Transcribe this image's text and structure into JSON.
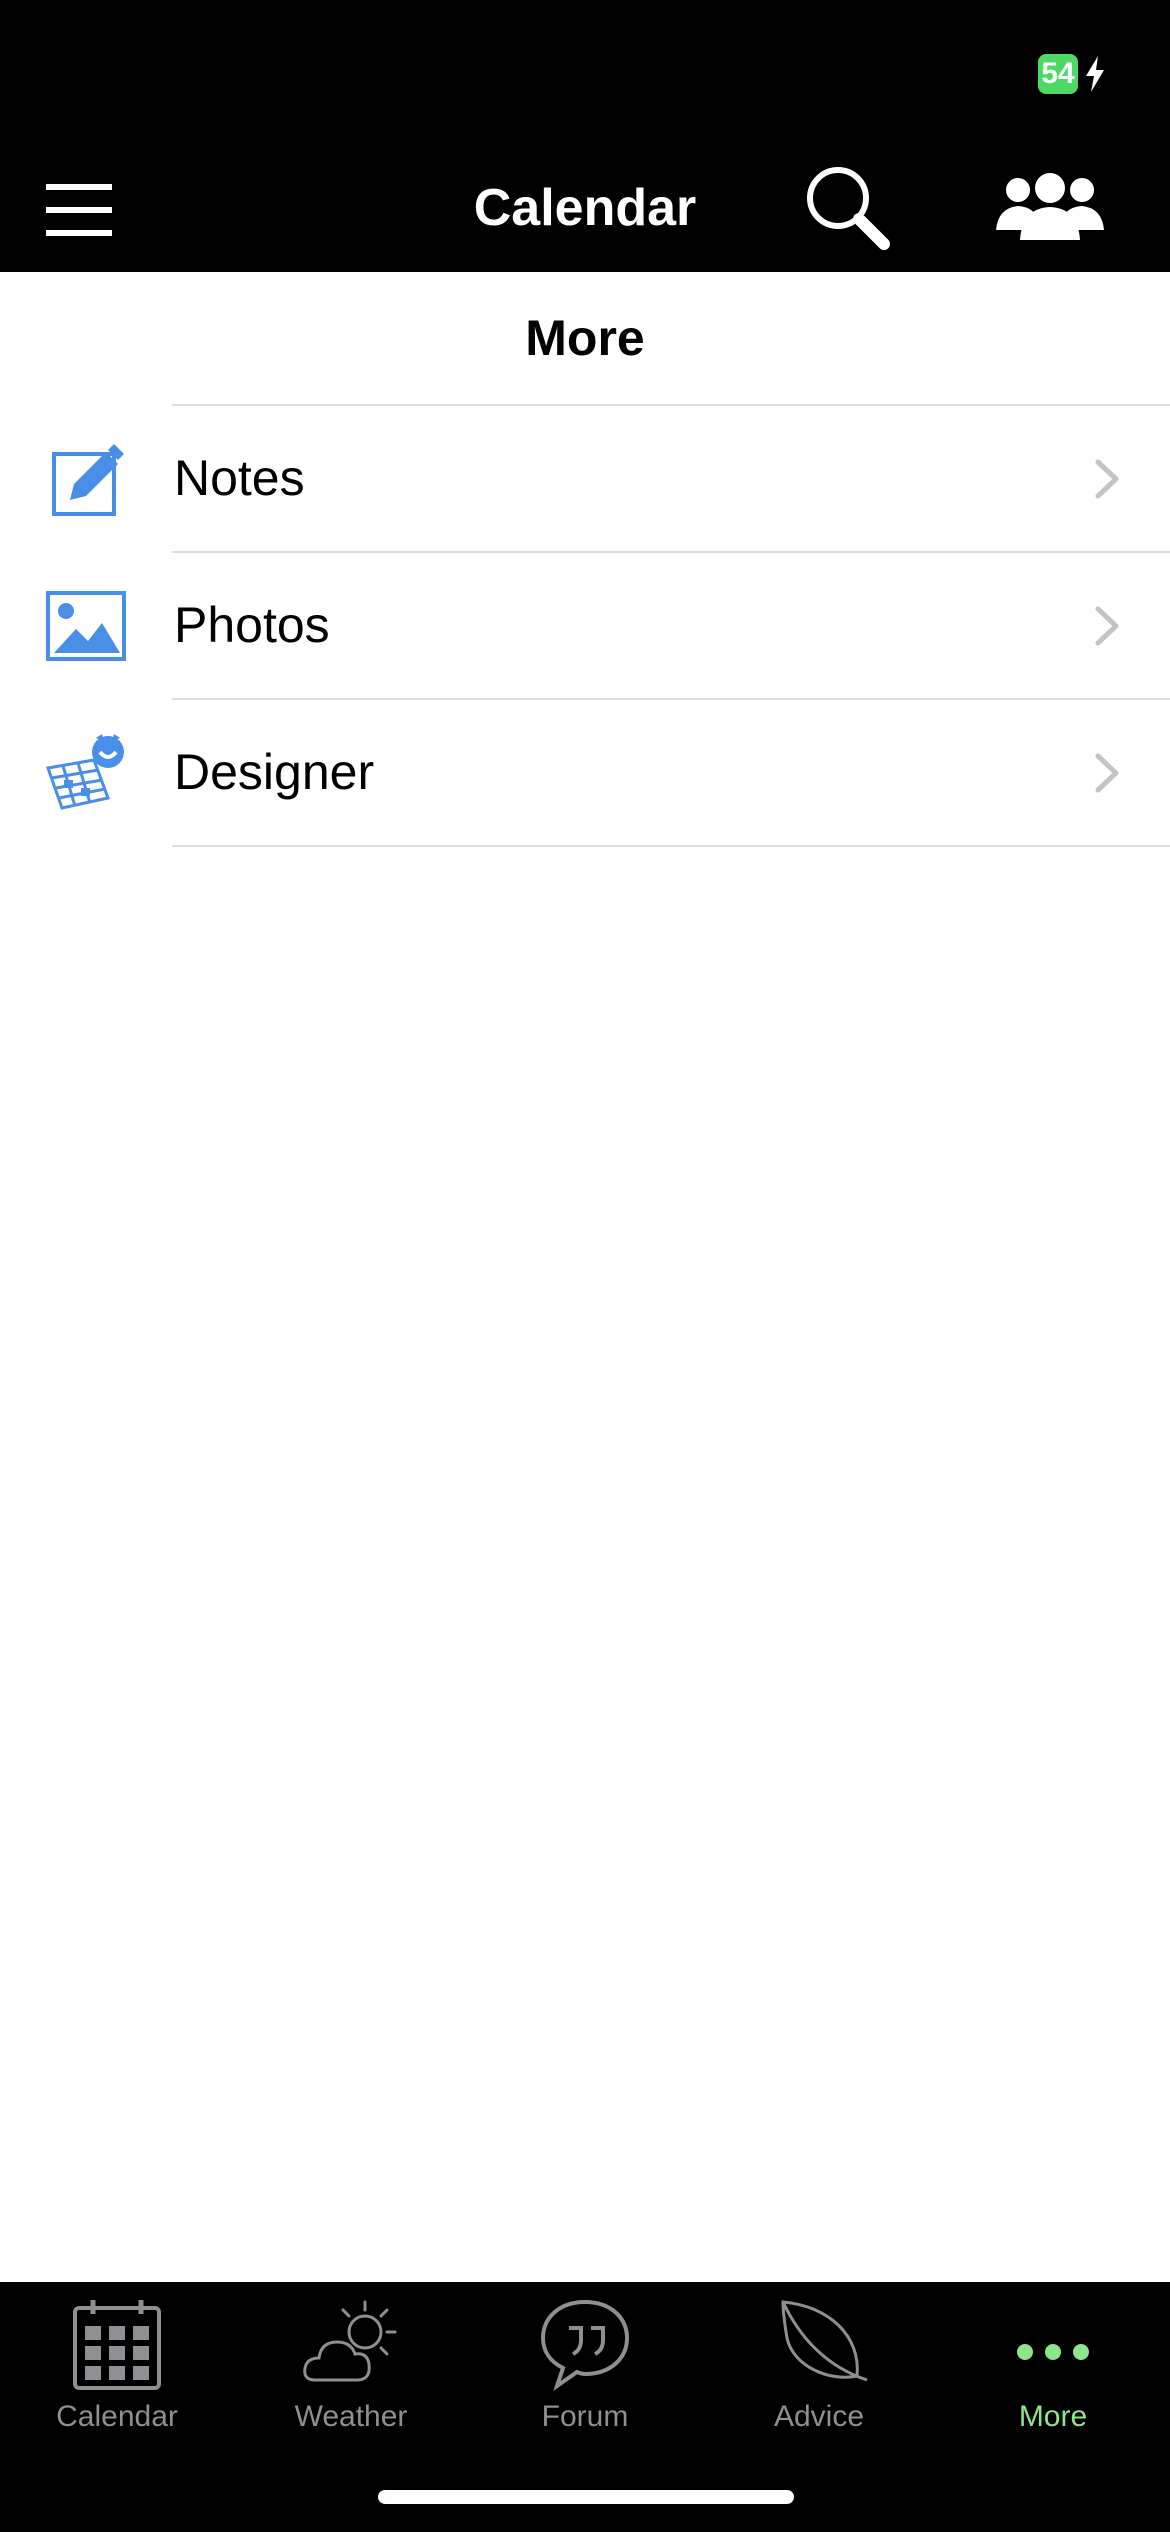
{
  "status_bar": {
    "battery_level": "54",
    "battery_color": "#4cd964"
  },
  "nav_bar": {
    "title": "Calendar",
    "icons": [
      "menu-icon",
      "search-icon",
      "people-icon"
    ]
  },
  "section": {
    "title": "More"
  },
  "list": {
    "items": [
      {
        "label": "Notes",
        "icon": "edit-note-icon"
      },
      {
        "label": "Photos",
        "icon": "photo-icon"
      },
      {
        "label": "Designer",
        "icon": "designer-icon"
      }
    ]
  },
  "tab_bar": {
    "tabs": [
      {
        "label": "Calendar",
        "icon": "calendar-grid-icon",
        "active": false
      },
      {
        "label": "Weather",
        "icon": "weather-icon",
        "active": false
      },
      {
        "label": "Forum",
        "icon": "forum-icon",
        "active": false
      },
      {
        "label": "Advice",
        "icon": "leaf-icon",
        "active": false
      },
      {
        "label": "More",
        "icon": "more-dots-icon",
        "active": true
      }
    ],
    "active_color": "#8ee68a",
    "inactive_color": "#8e8e93"
  },
  "accent_color": "#4a8fe7"
}
